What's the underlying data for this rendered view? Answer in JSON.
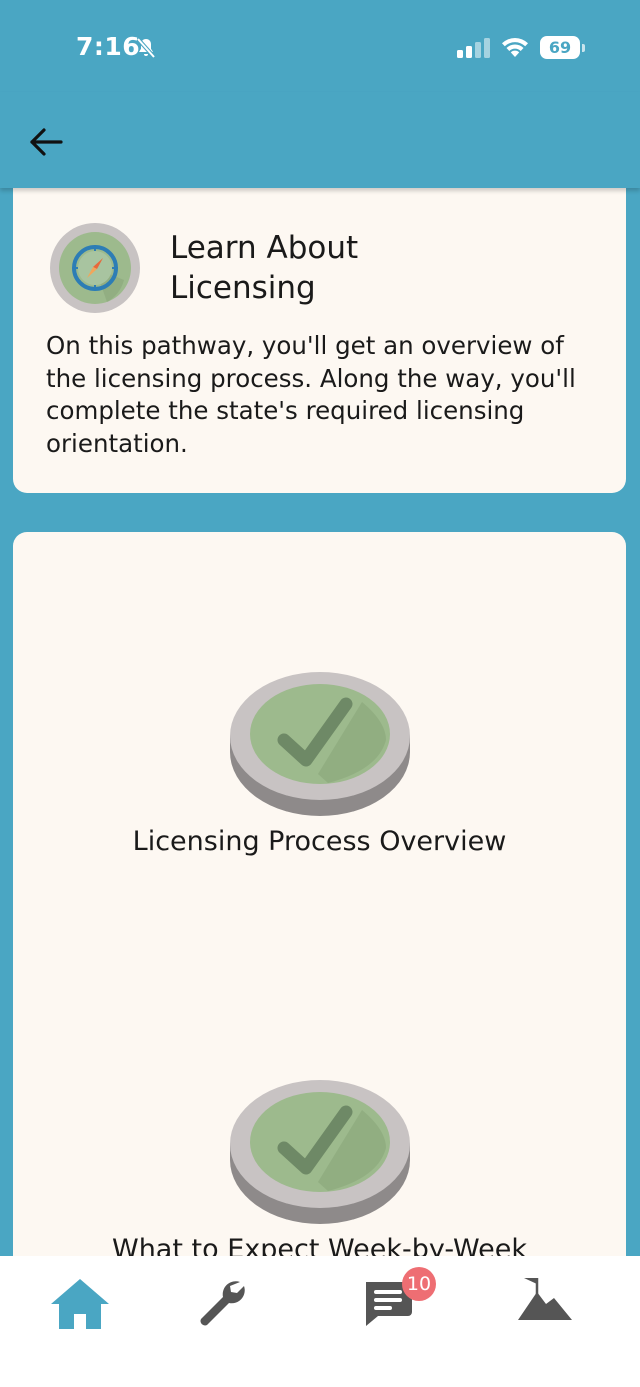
{
  "status_bar": {
    "time": "7:16",
    "battery": "69"
  },
  "app_bar": {
    "back_icon": "arrow-left-icon"
  },
  "pathway": {
    "icon": "compass-icon",
    "title": "Learn About Licensing",
    "description": "On this pathway, you'll get an overview of the licensing process. Along the way, you'll complete the state's required licensing orientation."
  },
  "steps": [
    {
      "label": "Licensing Process Overview",
      "status": "completed",
      "icon": "checkmark-icon"
    },
    {
      "label": "What to Expect Week-by-Week",
      "status": "completed",
      "icon": "checkmark-icon"
    }
  ],
  "bottom_nav": {
    "items": [
      {
        "icon": "home-icon",
        "active": true
      },
      {
        "icon": "wrench-icon",
        "active": false
      },
      {
        "icon": "chat-icon",
        "active": false,
        "badge": "10"
      },
      {
        "icon": "mountain-flag-icon",
        "active": false
      }
    ]
  },
  "colors": {
    "primary": "#4AA6C3",
    "card_bg": "#FDF8F2",
    "badge": "#EE6E73",
    "check_green": "#9DBA8D",
    "nav_icon": "#555555"
  }
}
